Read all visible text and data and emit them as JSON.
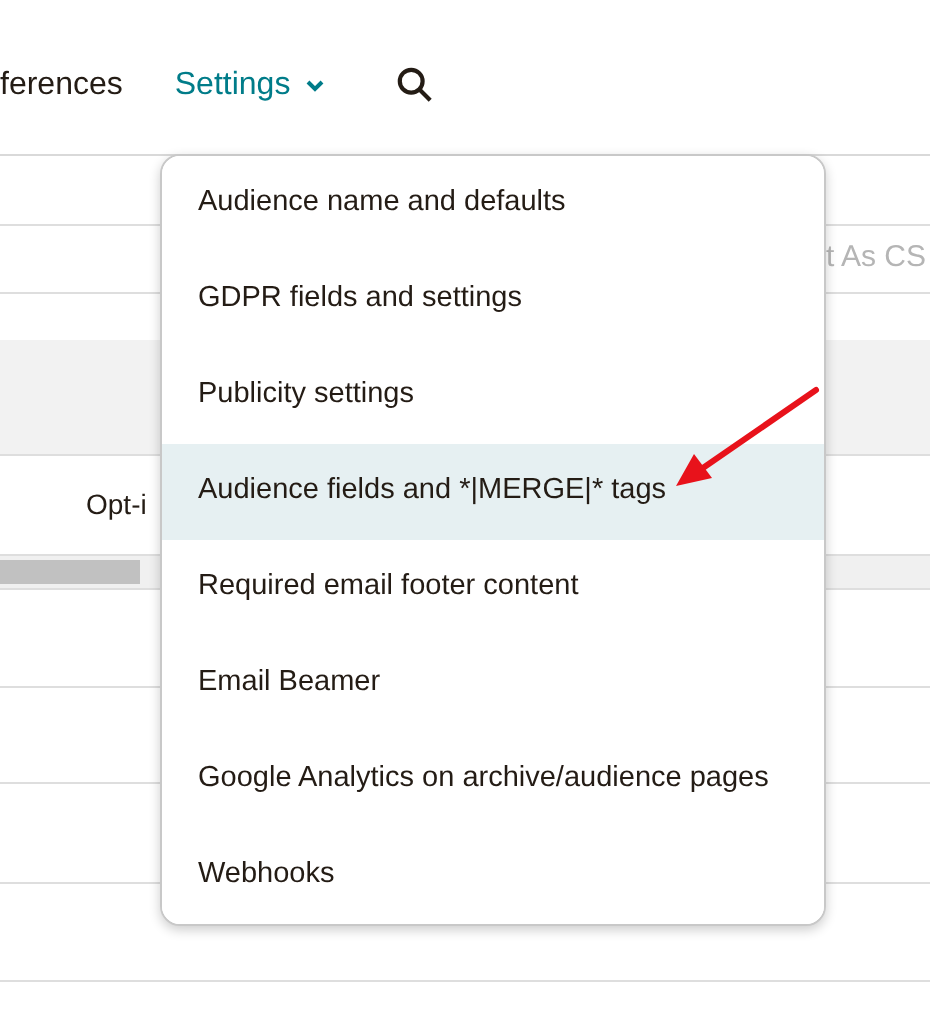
{
  "nav": {
    "items": [
      {
        "label": "ferences",
        "selected": false
      },
      {
        "label": "Settings",
        "selected": true
      }
    ]
  },
  "toolbar": {
    "export_button": "t As CS"
  },
  "table": {
    "rows": [
      {
        "cell": "Opt-i"
      }
    ]
  },
  "settings_menu": {
    "items": [
      {
        "label": "Audience name and defaults",
        "selected": false
      },
      {
        "label": "GDPR fields and settings",
        "selected": false
      },
      {
        "label": "Publicity settings",
        "selected": false
      },
      {
        "label": "Audience fields and *|MERGE|* tags",
        "selected": true
      },
      {
        "label": "Required email footer content",
        "selected": false
      },
      {
        "label": "Email Beamer",
        "selected": false
      },
      {
        "label": "Google Analytics on archive/audience pages",
        "selected": false
      },
      {
        "label": "Webhooks",
        "selected": false
      }
    ]
  }
}
